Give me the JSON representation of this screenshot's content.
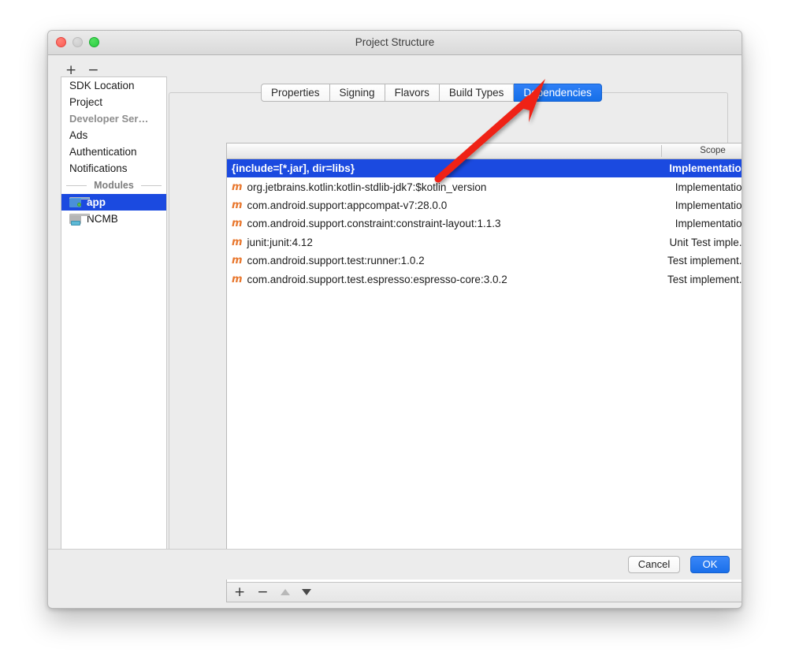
{
  "window": {
    "title": "Project Structure",
    "controls": {
      "close": "close-button",
      "minimize": "minimize-button",
      "zoom": "zoom-button"
    }
  },
  "sidebar": {
    "toolbar": {
      "add_label": "+",
      "remove_label": "−"
    },
    "items": [
      {
        "label": "SDK Location",
        "type": "item"
      },
      {
        "label": "Project",
        "type": "item"
      },
      {
        "label": "Developer Ser…",
        "type": "group"
      },
      {
        "label": "Ads",
        "type": "item"
      },
      {
        "label": "Authentication",
        "type": "item"
      },
      {
        "label": "Notifications",
        "type": "item"
      }
    ],
    "modules_separator": "Modules",
    "modules": [
      {
        "label": "app",
        "icon": "folder-app-icon",
        "selected": true
      },
      {
        "label": "NCMB",
        "icon": "folder-library-icon",
        "selected": false
      }
    ]
  },
  "tabs": [
    {
      "label": "Properties",
      "active": false
    },
    {
      "label": "Signing",
      "active": false
    },
    {
      "label": "Flavors",
      "active": false
    },
    {
      "label": "Build Types",
      "active": false
    },
    {
      "label": "Dependencies",
      "active": true
    }
  ],
  "table": {
    "columns": [
      "",
      "Scope"
    ],
    "scope_header": "Scope",
    "rows": [
      {
        "icon": "",
        "name": "{include=[*.jar], dir=libs}",
        "scope": "Implementation",
        "selected": true
      },
      {
        "icon": "m",
        "name": "org.jetbrains.kotlin:kotlin-stdlib-jdk7:$kotlin_version",
        "scope": "Implementation",
        "selected": false
      },
      {
        "icon": "m",
        "name": "com.android.support:appcompat-v7:28.0.0",
        "scope": "Implementation",
        "selected": false
      },
      {
        "icon": "m",
        "name": "com.android.support.constraint:constraint-layout:1.1.3",
        "scope": "Implementation",
        "selected": false
      },
      {
        "icon": "m",
        "name": "junit:junit:4.12",
        "scope": "Unit Test imple...",
        "selected": false
      },
      {
        "icon": "m",
        "name": "com.android.support.test:runner:1.0.2",
        "scope": "Test implement...",
        "selected": false
      },
      {
        "icon": "m",
        "name": "com.android.support.test.espresso:espresso-core:3.0.2",
        "scope": "Test implement...",
        "selected": false
      }
    ],
    "toolbar": {
      "add_label": "+",
      "remove_label": "−",
      "move_up": "move-up",
      "move_down": "move-down",
      "move_up_enabled": false,
      "move_down_enabled": true
    }
  },
  "footer": {
    "cancel_label": "Cancel",
    "ok_label": "OK"
  },
  "annotation": {
    "type": "arrow",
    "color": "#ef2412",
    "points_to": "Dependencies"
  },
  "colors": {
    "selection_blue": "#1b4ae0",
    "tab_active_blue": "#1a6fea",
    "accent_orange": "#e8762c",
    "annotation_red": "#ef2412",
    "window_bg": "#ececec"
  }
}
